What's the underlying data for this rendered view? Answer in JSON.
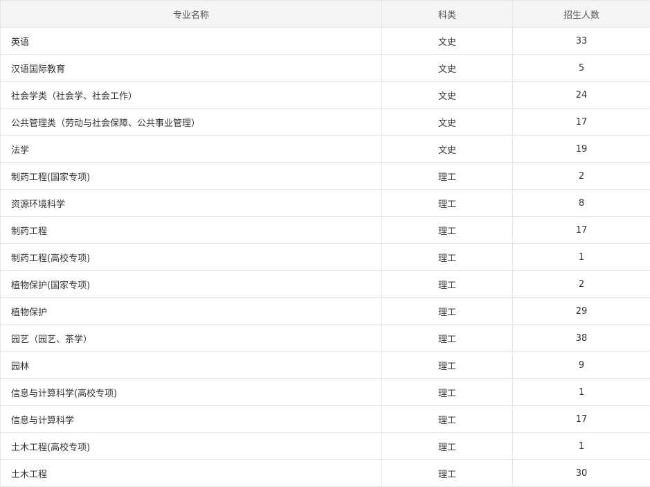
{
  "table": {
    "headers": [
      "专业名称",
      "科类",
      "招生人数"
    ],
    "rows": [
      {
        "name": "英语",
        "category": "文史",
        "count": "33"
      },
      {
        "name": "汉语国际教育",
        "category": "文史",
        "count": "5"
      },
      {
        "name": "社会学类（社会学、社会工作）",
        "category": "文史",
        "count": "24"
      },
      {
        "name": "公共管理类（劳动与社会保障、公共事业管理）",
        "category": "文史",
        "count": "17"
      },
      {
        "name": "法学",
        "category": "文史",
        "count": "19"
      },
      {
        "name": "制药工程(国家专项)",
        "category": "理工",
        "count": "2"
      },
      {
        "name": "资源环境科学",
        "category": "理工",
        "count": "8"
      },
      {
        "name": "制药工程",
        "category": "理工",
        "count": "17"
      },
      {
        "name": "制药工程(高校专项)",
        "category": "理工",
        "count": "1"
      },
      {
        "name": "植物保护(国家专项)",
        "category": "理工",
        "count": "2"
      },
      {
        "name": "植物保护",
        "category": "理工",
        "count": "29"
      },
      {
        "name": "园艺（园艺、茶学）",
        "category": "理工",
        "count": "38"
      },
      {
        "name": "园林",
        "category": "理工",
        "count": "9"
      },
      {
        "name": "信息与计算科学(高校专项)",
        "category": "理工",
        "count": "1"
      },
      {
        "name": "信息与计算科学",
        "category": "理工",
        "count": "17"
      },
      {
        "name": "土木工程(高校专项)",
        "category": "理工",
        "count": "1"
      },
      {
        "name": "土木工程",
        "category": "理工",
        "count": "30"
      }
    ]
  }
}
